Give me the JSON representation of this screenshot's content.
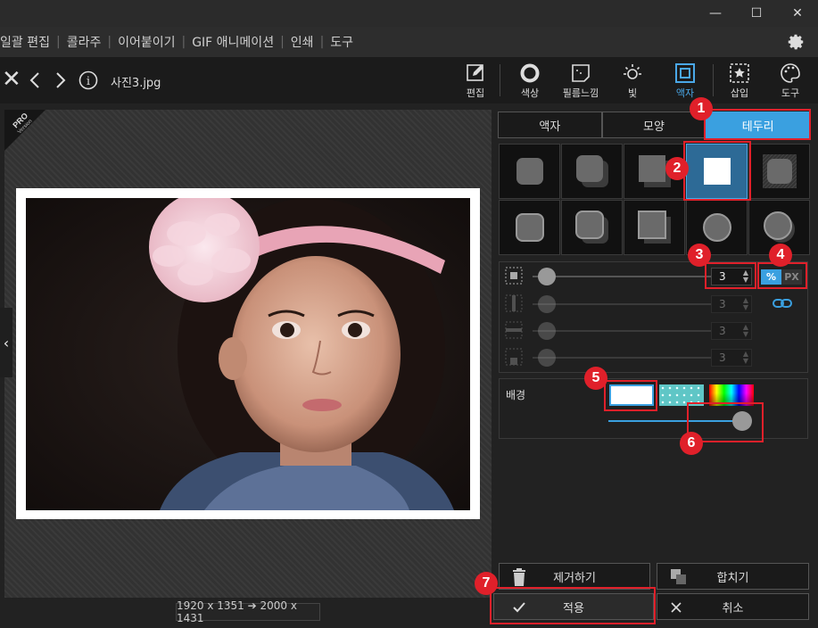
{
  "window": {
    "minimize": "—",
    "maximize": "☐",
    "close": "✕"
  },
  "menu": [
    "일괄 편집",
    "콜라주",
    "이어붙이기",
    "GIF 애니메이션",
    "인쇄",
    "도구"
  ],
  "toolbar": {
    "file_name": "사진3.jpg",
    "tools": [
      {
        "label": "편집",
        "icon": "edit-icon"
      },
      {
        "label": "색상",
        "icon": "circle-icon"
      },
      {
        "label": "필름느낌",
        "icon": "film-icon"
      },
      {
        "label": "빛",
        "icon": "sun-icon"
      },
      {
        "label": "액자",
        "icon": "frame-icon",
        "active": true
      },
      {
        "label": "삽입",
        "icon": "insert-icon"
      },
      {
        "label": "도구",
        "icon": "palette-icon"
      }
    ]
  },
  "canvas": {
    "pro_badge": "PRO",
    "pro_sub": "Version",
    "dimensions": "1920 x 1351 ➔ 2000 x 1431"
  },
  "panel": {
    "tabs": [
      "액자",
      "모양",
      "테두리"
    ],
    "active_tab": 2,
    "spin_values": [
      "3",
      "3",
      "3",
      "3"
    ],
    "unit_percent": "%",
    "unit_px": "PX",
    "background_label": "배경",
    "remove_label": "제거하기",
    "merge_label": "합치기",
    "apply_label": "적용",
    "cancel_label": "취소"
  },
  "annotations": [
    "1",
    "2",
    "3",
    "4",
    "5",
    "6",
    "7"
  ],
  "colors": {
    "accent": "#3aa0e0",
    "annotation": "#e0202a"
  }
}
